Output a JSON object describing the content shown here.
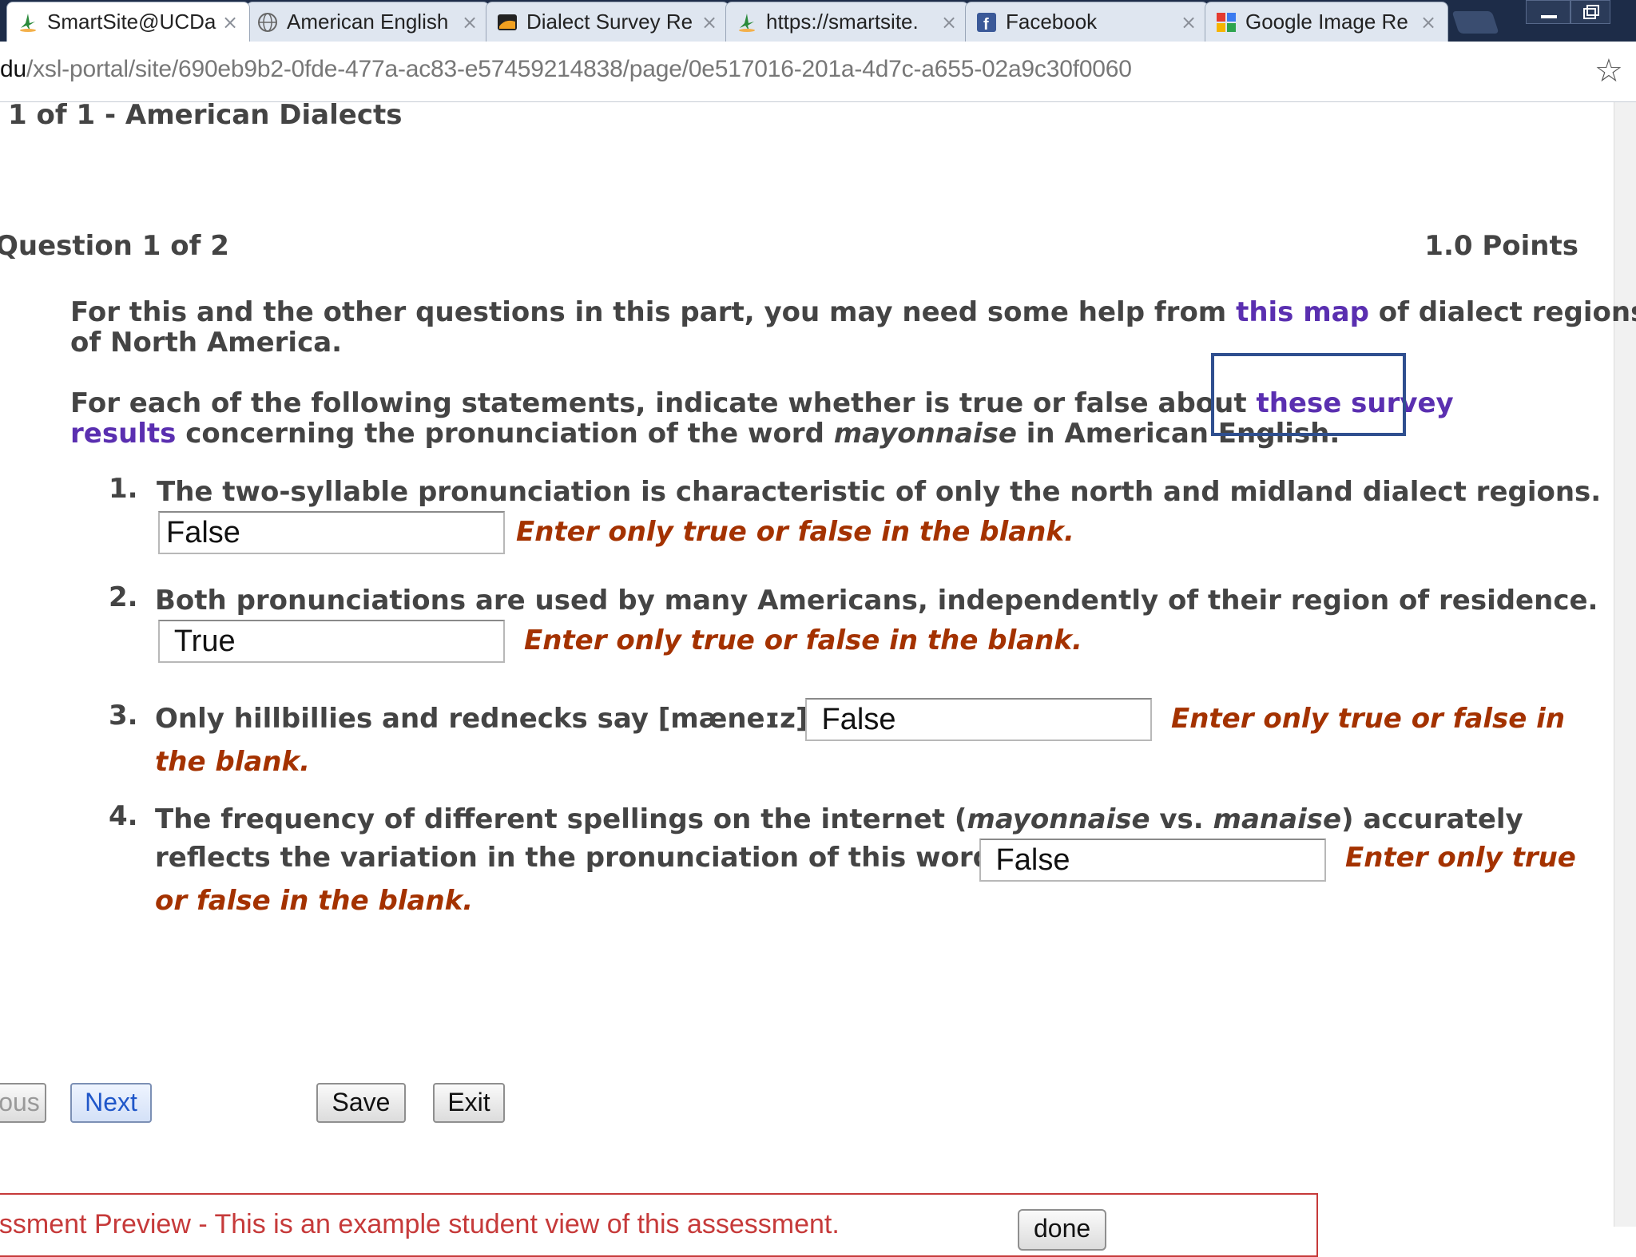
{
  "browser": {
    "tabs": [
      {
        "title": "SmartSite@UCDa",
        "icon": "smartsite-icon",
        "active": true
      },
      {
        "title": "American English",
        "icon": "globe-icon",
        "active": false
      },
      {
        "title": "Dialect Survey Re",
        "icon": "dialect-survey-icon",
        "active": false
      },
      {
        "title": "https://smartsite.",
        "icon": "smartsite-icon",
        "active": false
      },
      {
        "title": "Facebook",
        "icon": "facebook-icon",
        "active": false
      },
      {
        "title": "Google Image Re",
        "icon": "google-icon",
        "active": false
      }
    ],
    "close_glyph": "×",
    "url_domain": "du",
    "url_path": "/xsl-portal/site/690eb9b2-0fde-477a-ac83-e57459214838/page/0e517016-201a-4d7c-a655-02a9c30f0060",
    "star_glyph": "☆",
    "facebook_glyph": "f"
  },
  "page": {
    "part_title": "1 of 1 - American Dialects",
    "question_title": "Question 1 of 2",
    "points": "1.0 Points",
    "intro1_pre": "For this and the other questions in this part, you may need some help from ",
    "intro1_link": "this map",
    "intro1_post": " of dialect regions",
    "intro1_line2": "of North America.",
    "intro2_pre": "For each of the following statements, indicate whether is true or false about ",
    "intro2_link1": "these survey",
    "intro2_link2": "results",
    "intro2_mid": " concerning the pronunciation of the word ",
    "intro2_word": "mayonnaise",
    "intro2_post": " in American English.",
    "hint": "Enter only true or false in the blank.",
    "hint_q3_a": "Enter only true or false in",
    "hint_q3_b": "the blank.",
    "hint_q4_a": "Enter only true",
    "hint_q4_b": "or false in the blank.",
    "questions": [
      {
        "num": "1.",
        "text": "The two-syllable pronunciation is characteristic of only the north and midland dialect regions.",
        "answer": "False"
      },
      {
        "num": "2.",
        "text": "Both pronunciations are used by many Americans, independently of their region of residence.",
        "answer": " True"
      },
      {
        "num": "3.",
        "text": "Only hillbillies and rednecks say [mæneɪz].",
        "answer": " False"
      },
      {
        "num": "4.",
        "text_a1": "The frequency of different spellings on the internet (",
        "text_a_it1": "mayonnaise",
        "text_a2": " vs. ",
        "text_a_it2": "manaise",
        "text_a3": ") accurately",
        "text_b": "reflects the variation in the pronunciation of this word.",
        "answer": " False"
      }
    ]
  },
  "buttons": {
    "previous": "ous",
    "next": "Next",
    "save": "Save",
    "exit": "Exit"
  },
  "preview": {
    "text": "essment Preview - This is an example student view of this assessment.",
    "done": "done"
  },
  "colors": {
    "link": "#5a2fb0",
    "hint": "#a43200",
    "tabbar": "#1d2c48"
  }
}
